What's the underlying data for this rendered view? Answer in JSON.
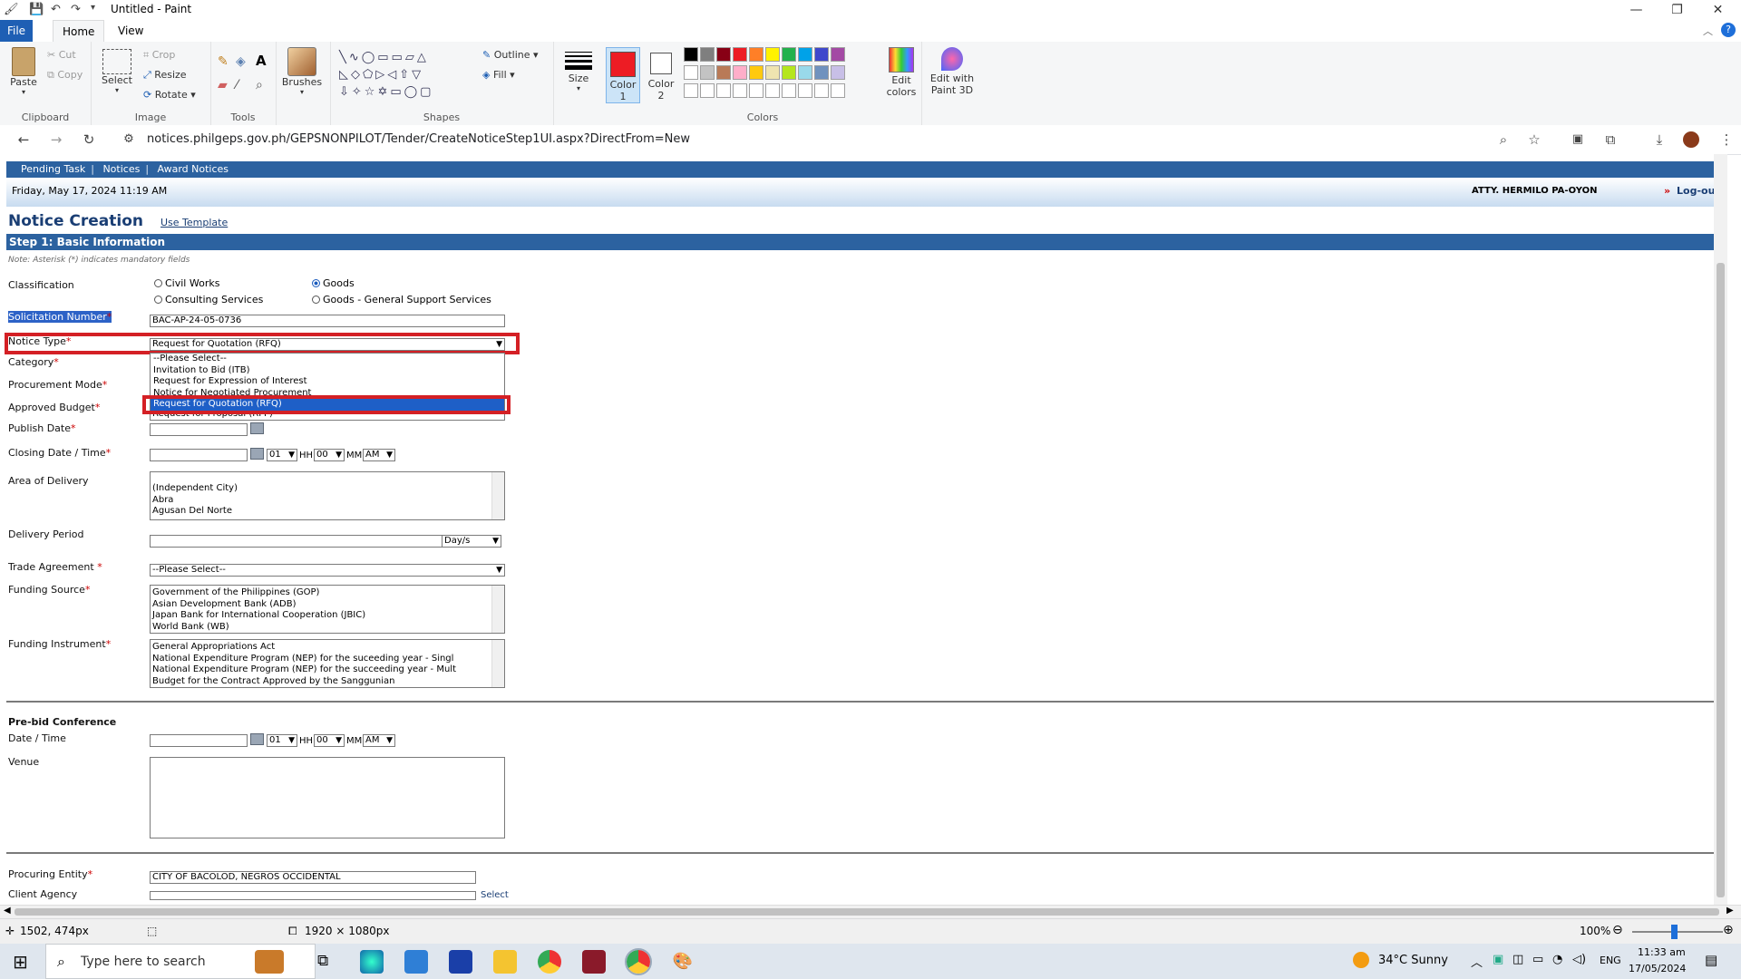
{
  "paint": {
    "title": "Untitled - Paint",
    "tabs": {
      "file": "File",
      "home": "Home",
      "view": "View"
    },
    "clipboard": {
      "paste": "Paste",
      "cut": "Cut",
      "copy": "Copy",
      "group": "Clipboard"
    },
    "image": {
      "select": "Select",
      "crop": "Crop",
      "resize": "Resize",
      "rotate": "Rotate",
      "group": "Image"
    },
    "tools": {
      "group": "Tools"
    },
    "brushes": "Brushes",
    "shapes": {
      "outline": "Outline",
      "fill": "Fill",
      "group": "Shapes"
    },
    "size": "Size",
    "color1": {
      "label": "Color",
      "num": "1"
    },
    "color2": {
      "label": "Color",
      "num": "2"
    },
    "colors_group": "Colors",
    "edit_colors": {
      "line1": "Edit",
      "line2": "colors"
    },
    "paint3d": {
      "line1": "Edit with",
      "line2": "Paint 3D"
    },
    "palette_row1": [
      "#000000",
      "#7f7f7f",
      "#880015",
      "#ed1c24",
      "#ff7f27",
      "#fff200",
      "#22b14c",
      "#00a2e8",
      "#3f48cc",
      "#a349a4"
    ],
    "palette_row2": [
      "#ffffff",
      "#c3c3c3",
      "#b97a57",
      "#ffaec9",
      "#ffc90e",
      "#efe4b0",
      "#b5e61d",
      "#99d9ea",
      "#7092be",
      "#c8bfe7"
    ],
    "color1_value": "#ed1c24",
    "status": {
      "cursor": "1502, 474px",
      "dimensions": "1920 × 1080px",
      "zoom": "100%"
    }
  },
  "browser": {
    "url": "notices.philgeps.gov.ph/GEPSNONPILOT/Tender/CreateNoticeStep1UI.aspx?DirectFrom=New"
  },
  "site": {
    "nav": [
      "Pending Task",
      "Notices",
      "Award Notices"
    ],
    "date": "Friday, May 17, 2024 11:19 AM",
    "user": "ATTY. HERMILO PA-OYON",
    "logout": "Log-out",
    "page_title": "Notice Creation",
    "use_template": "Use Template",
    "step_title": "Step 1: Basic Information",
    "note": "Note: Asterisk (*) indicates mandatory fields"
  },
  "form": {
    "classification": {
      "label": "Classification",
      "options": [
        "Civil Works",
        "Goods",
        "Consulting Services",
        "Goods - General Support Services"
      ],
      "selected": "Goods"
    },
    "solicitation": {
      "label": "Solicitation Number",
      "value": "BAC-AP-24-05-0736"
    },
    "notice_type": {
      "label": "Notice Type",
      "value": "Request for Quotation (RFQ)",
      "options": [
        "--Please Select--",
        "Invitation to Bid (ITB)",
        "Request for Expression of Interest",
        "Notice for Negotiated Procurement",
        "Request for Quotation (RFQ)",
        "Request for Proposal (RFP)"
      ]
    },
    "category": {
      "label": "Category"
    },
    "procurement_mode": {
      "label": "Procurement Mode"
    },
    "approved_budget": {
      "label": "Approved Budget"
    },
    "publish_date": {
      "label": "Publish Date"
    },
    "closing": {
      "label": "Closing Date / Time",
      "hh": "01",
      "hh_label": "HH",
      "mm": "00",
      "mm_label": "MM",
      "ampm": "AM"
    },
    "area_of_delivery": {
      "label": "Area of Delivery",
      "options": [
        "(Independent City)",
        "Abra",
        "Agusan Del Norte"
      ]
    },
    "delivery_period": {
      "label": "Delivery Period",
      "unit": "Day/s"
    },
    "trade_agreement": {
      "label": "Trade Agreement",
      "value": "--Please Select--"
    },
    "funding_source": {
      "label": "Funding Source",
      "options": [
        "Government of the Philippines (GOP)",
        "Asian Development Bank (ADB)",
        "Japan Bank for International Cooperation (JBIC)",
        "World Bank (WB)"
      ]
    },
    "funding_instrument": {
      "label": "Funding Instrument",
      "options": [
        "General Appropriations Act",
        "National Expenditure Program (NEP) for the suceeding year - Singl",
        "National Expenditure Program (NEP) for the succeeding year - Mult",
        "Budget for the Contract Approved by the Sanggunian"
      ]
    },
    "prebid": {
      "section": "Pre-bid Conference",
      "date_label": "Date / Time",
      "venue_label": "Venue",
      "hh": "01",
      "hh_label": "HH",
      "mm": "00",
      "mm_label": "MM",
      "ampm": "AM"
    },
    "procuring_entity": {
      "label": "Procuring Entity",
      "value": "CITY OF BACOLOD, NEGROS OCCIDENTAL"
    },
    "client_agency": {
      "label": "Client Agency",
      "select_link": "Select"
    }
  },
  "taskbar": {
    "search_placeholder": "Type here to search",
    "weather": "34°C  Sunny",
    "lang": "ENG",
    "time": "11:33 am",
    "date": "17/05/2024"
  }
}
